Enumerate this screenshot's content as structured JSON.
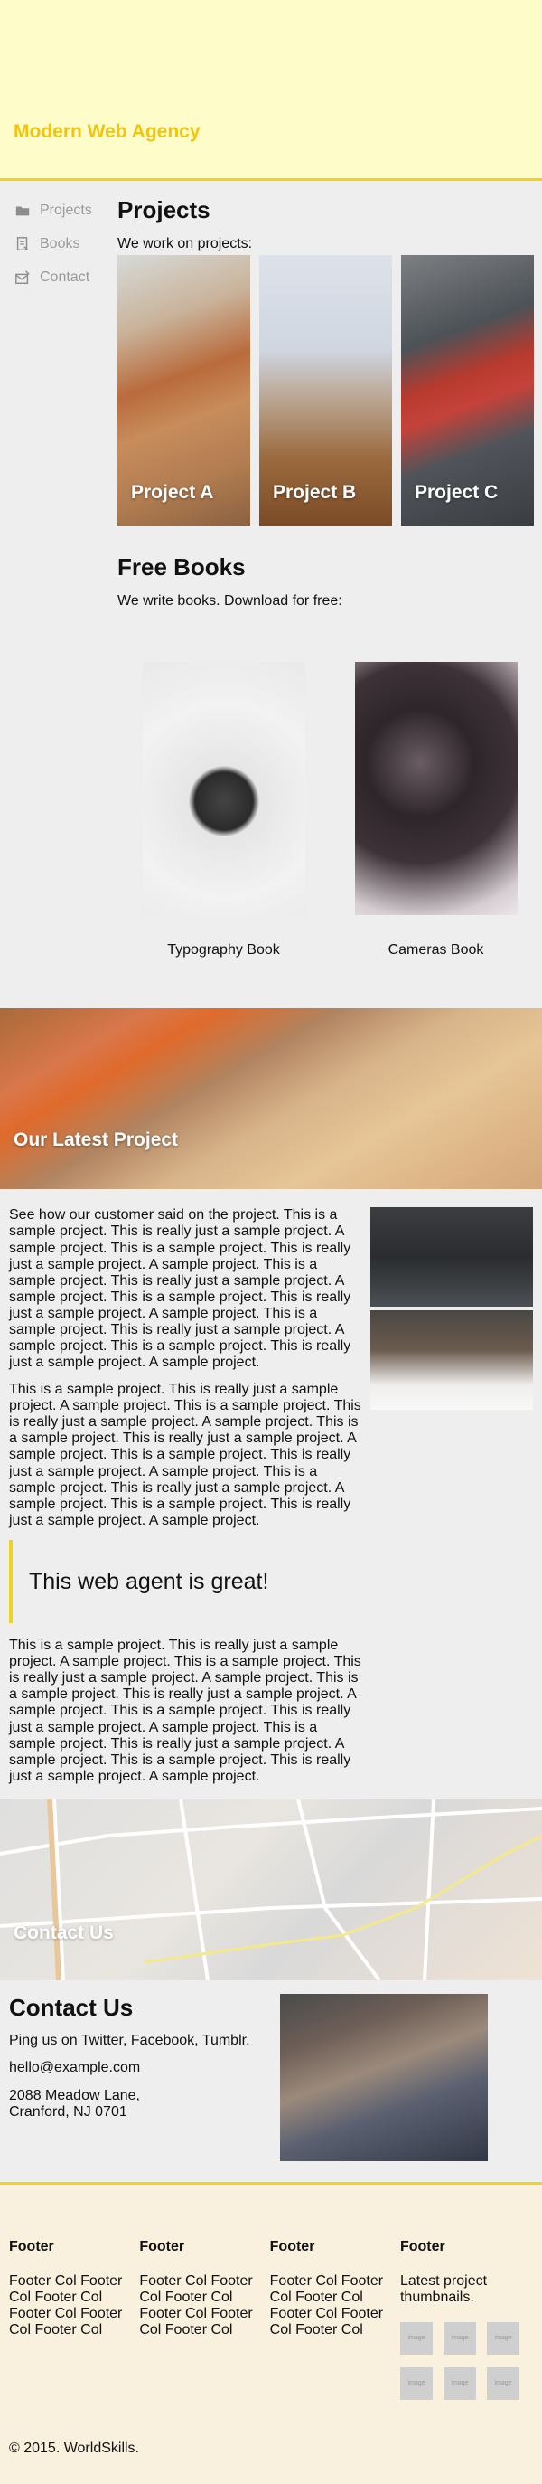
{
  "header": {
    "brand": "Modern Web Agency"
  },
  "sidebar": {
    "items": [
      {
        "label": "Projects",
        "icon": "folder-icon"
      },
      {
        "label": "Books",
        "icon": "book-icon"
      },
      {
        "label": "Contact",
        "icon": "contact-icon"
      }
    ]
  },
  "projects": {
    "title": "Projects",
    "subtitle": "We work on projects:",
    "items": [
      {
        "label": "Project A"
      },
      {
        "label": "Project B"
      },
      {
        "label": "Project C"
      }
    ]
  },
  "books": {
    "title": "Free Books",
    "subtitle": "We write books. Download for free:",
    "items": [
      {
        "label": "Typography Book"
      },
      {
        "label": "Cameras Book"
      }
    ]
  },
  "banner": {
    "label": "Our Latest Project"
  },
  "story": {
    "p1": "See how our customer said on the project. This is a sample project. This is really just a sample project. A sample project. This is a sample project. This is really just a sample project. A sample project. This is a sample project. This is really just a sample project. A sample project. This is a sample project. This is really just a sample project. A sample project. This is a sample project. This is really just a sample project. A sample project. This is a sample project. This is really just a sample project. A sample project.",
    "p2": "This is a sample project. This is really just a sample project. A sample project. This is a sample project. This is really just a sample project. A sample project. This is a sample project. This is really just a sample project. A sample project. This is a sample project. This is really just a sample project. A sample project. This is a sample project. This is really just a sample project. A sample project. This is a sample project. This is really just a sample project. A sample project.",
    "quote": "This web agent is great!",
    "p3": "This is a sample project. This is really just a sample project. A sample project. This is a sample project. This is really just a sample project. A sample project. This is a sample project. This is really just a sample project. A sample project. This is a sample project. This is really just a sample project. A sample project. This is a sample project. This is really just a sample project. A sample project. This is a sample project. This is really just a sample project. A sample project."
  },
  "map": {
    "label": "Contact Us"
  },
  "contact": {
    "title": "Contact Us",
    "social": "Ping us on Twitter, Facebook, Tumblr.",
    "email": "hello@example.com",
    "address1": "2088 Meadow Lane,",
    "address2": "Cranford, NJ 0701"
  },
  "footer": {
    "cols": [
      {
        "title": "Footer",
        "text": "Footer Col Footer Col Footer Col Footer Col Footer Col Footer Col"
      },
      {
        "title": "Footer",
        "text": "Footer Col Footer Col Footer Col Footer Col Footer Col Footer Col"
      },
      {
        "title": "Footer",
        "text": "Footer Col Footer Col Footer Col Footer Col Footer Col Footer Col"
      },
      {
        "title": "Footer",
        "text": "Latest project thumbnails."
      }
    ],
    "thumb_label": "image",
    "copyright": "© 2015. WorldSkills."
  },
  "colors": {
    "accent": "#f3d21a",
    "brand": "#f1c40f",
    "header_bg": "#fefcc8",
    "footer_bg": "#f9f0dd"
  }
}
